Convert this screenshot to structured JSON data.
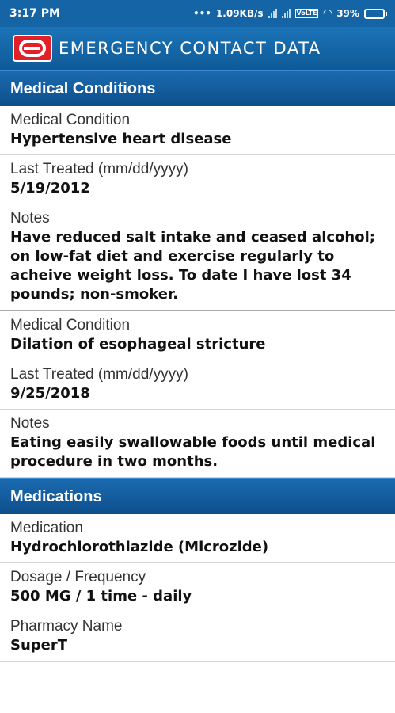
{
  "status_bar": {
    "time": "3:17 PM",
    "dots": "•••",
    "speed": "1.09KB/s",
    "battery": "39%",
    "volte": "VoLTE",
    "wifi_icon": "wifi-icon",
    "battery_level": 0.39
  },
  "header": {
    "title": "EMERGENCY CONTACT DATA",
    "logo_icon": "ecd-logo-icon"
  },
  "sections": {
    "medical_conditions": {
      "title": "Medical Conditions",
      "entries": [
        {
          "condition_label": "Medical Condition",
          "condition": "Hypertensive heart disease",
          "treated_label": "Last Treated (mm/dd/yyyy)",
          "treated": "5/19/2012",
          "notes_label": "Notes",
          "notes": "Have reduced salt intake and ceased alcohol; on low-fat diet and exercise regularly to acheive weight loss. To date I have lost 34 pounds; non-smoker."
        },
        {
          "condition_label": "Medical Condition",
          "condition": "Dilation of esophageal stricture",
          "treated_label": "Last Treated (mm/dd/yyyy)",
          "treated": "9/25/2018",
          "notes_label": "Notes",
          "notes": "Eating easily swallowable foods until medical procedure in two months."
        }
      ]
    },
    "medications": {
      "title": "Medications",
      "medication_label": "Medication",
      "medication": "Hydrochlorothiazide (Microzide)",
      "dosage_label": "Dosage / Frequency",
      "dosage": "500 MG / 1 time - daily",
      "pharmacy_label": "Pharmacy Name",
      "pharmacy": "SuperT"
    }
  },
  "colors": {
    "status_bar": "#1565a6",
    "header": "#0f5a97",
    "logo": "#e12028"
  }
}
